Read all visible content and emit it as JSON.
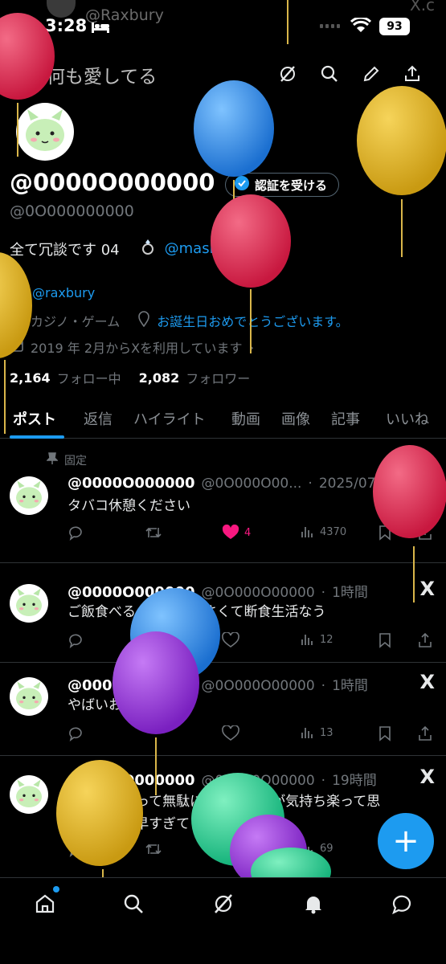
{
  "status": {
    "time": "3:28",
    "battery": "93",
    "ghost_handle": "@Raxbury",
    "corner_text": "X.c"
  },
  "header": {
    "title": "何も愛してる"
  },
  "profile": {
    "display_name": "@0000O000000",
    "verify_label": "認証を受ける",
    "handle": "@0O000000000",
    "bio_text": "全て冗談です 04",
    "bio_mention": "@mash_hsam_",
    "linked_account": "@raxbury",
    "category": "カジノ・ゲーム",
    "birthday": "お誕生日おめでとうございます。",
    "joined": "2019 年 2月からXを利用しています",
    "following_count": "2,164",
    "following_label": "フォロー中",
    "followers_count": "2,082",
    "followers_label": "フォロワー"
  },
  "tabs": [
    "ポスト",
    "返信",
    "ハイライト",
    "動画",
    "画像",
    "記事",
    "いいね"
  ],
  "pinned_label": "固定",
  "posts": [
    {
      "name": "@0000O000000",
      "handle": "@0O000O00...",
      "time": "2025/07/25",
      "text": "タバコ休憩ください",
      "likes": "4",
      "views": "4370"
    },
    {
      "name": "@0000O000000",
      "handle": "@0O000O00000",
      "time": "1時間",
      "text": "ご飯食べるのめんどくさくて断食生活なう",
      "likes": "",
      "views": "12"
    },
    {
      "name": "@0000O000000",
      "handle": "@0O000O00000",
      "time": "1時間",
      "text": "やばいおわった",
      "likes": "",
      "views": "13"
    },
    {
      "name": "@0000O000000",
      "handle": "@0O000O00000",
      "time": "19時間",
      "text_line1": "こういう日って無駄に早く出た方が気持ち楽って思",
      "text_line2": "ってたけど早すぎてどうしよう",
      "likes": "",
      "views": "69"
    }
  ],
  "colors": {
    "accent": "#1d9bf0",
    "like": "#f91880",
    "background": "#000000"
  }
}
